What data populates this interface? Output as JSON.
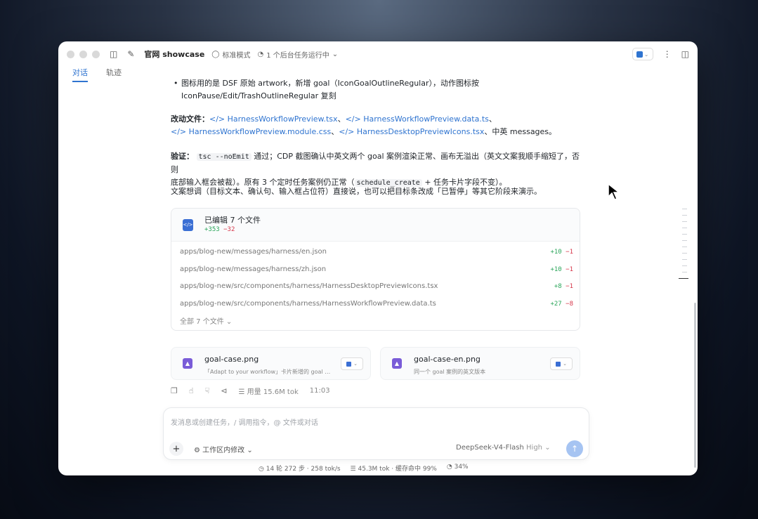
{
  "titlebar": {
    "title": "官网 showcase",
    "mode": "标准模式",
    "tasks": "1 个后台任务运行中"
  },
  "tabs": [
    {
      "label": "对话",
      "active": true
    },
    {
      "label": "轨迹",
      "active": false
    }
  ],
  "message": {
    "bullet_line1": "图标用的是 DSF 原始 artwork，新增 goal（IconGoalOutlineRegular），动作图标按",
    "bullet_line2": "IconPause/Edit/TrashOutlineRegular 复刻",
    "changed_label": "改动文件：",
    "changed_files": [
      "HarnessWorkflowPreview.tsx",
      "HarnessWorkflowPreview.data.ts",
      "HarnessWorkflowPreview.module.css",
      "HarnessDesktopPreviewIcons.tsx"
    ],
    "changed_suffix": "、中英 messages。",
    "verify_label": "验证：",
    "verify_code": "tsc --noEmit",
    "verify_text1": "通过；CDP 截图确认中英文两个 goal 案例渲染正常、画布无溢出（英文文案我顺手缩短了，否则",
    "verify_text2a": "底部输入框会被裁）。原有 3 个定时任务案例仍正常（",
    "verify_code2": "schedule_create",
    "verify_text2b": "+ 任务卡片字段不变）。",
    "copy_note": "文案想调（目标文本、确认句、输入框占位符）直接说，也可以把目标条改成「已暂停」等其它阶段来演示。"
  },
  "edit_card": {
    "title": "已编辑 7 个文件",
    "added": "+353",
    "removed": "−32",
    "files": [
      {
        "path": "apps/blog-new/messages/harness/en.json",
        "added": "+10",
        "removed": "−1"
      },
      {
        "path": "apps/blog-new/messages/harness/zh.json",
        "added": "+10",
        "removed": "−1"
      },
      {
        "path": "apps/blog-new/src/components/harness/HarnessDesktopPreviewIcons.tsx",
        "added": "+8",
        "removed": "−1"
      },
      {
        "path": "apps/blog-new/src/components/harness/HarnessWorkflowPreview.data.ts",
        "added": "+27",
        "removed": "−8"
      }
    ],
    "all_files": "全部 7 个文件"
  },
  "attachments": [
    {
      "name": "goal-case.png",
      "desc": "「Adapt to your workflow」卡片新增的 goal 案例（..."
    },
    {
      "name": "goal-case-en.png",
      "desc": "同一个 goal 案例的英文版本"
    }
  ],
  "actions": {
    "usage": "用量 15.6M tok",
    "time": "11:03"
  },
  "composer": {
    "placeholder": "发消息或创建任务，/ 调用指令，@ 文件或对话",
    "scope": "工作区内修改",
    "model": "DeepSeek-V4-Flash",
    "effort": "High"
  },
  "statusbar": {
    "turns": "14 轮 272 步 · 258 tok/s",
    "cache": "45.3M tok · 缓存命中 99%",
    "context": "34%"
  },
  "colors": {
    "accent": "#2f74d0",
    "add": "#2aa55a",
    "del": "#d6364a"
  }
}
